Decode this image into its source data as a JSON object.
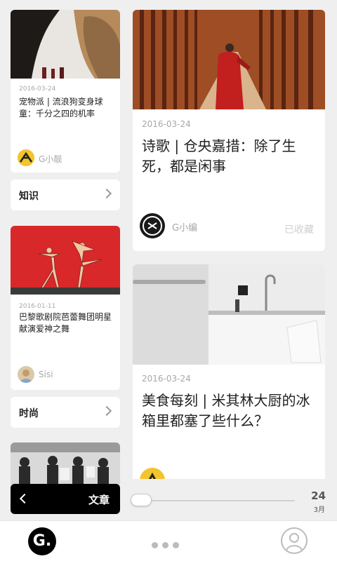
{
  "left_cards": [
    {
      "date": "2016-03-24",
      "title": "宠物派 | 流浪狗变身球童：千分之四的机率",
      "author": "G小靓"
    },
    {
      "date": "2016-01-11",
      "title": "巴黎歌剧院芭蕾舞团明星献演爱神之舞",
      "author": "Sisi"
    }
  ],
  "categories": [
    {
      "label": "知识"
    },
    {
      "label": "时尚"
    }
  ],
  "right_cards": [
    {
      "date": "2016-03-24",
      "title": "诗歌 | 仓央嘉措：除了生死，都是闲事",
      "author": "G小编",
      "status": "已收藏"
    },
    {
      "date": "2016-03-24",
      "title": "美食每刻 | 米其林大厨的冰箱里都塞了些什么？"
    }
  ],
  "article_pill": {
    "label": "文章"
  },
  "date_slider": {
    "day": "24",
    "month": "3月",
    "progress": 0.05
  },
  "tabbar": {
    "logo": "G.",
    "icons": [
      "more-dots-icon",
      "user-profile-icon"
    ]
  },
  "colors": {
    "accent": "#000000",
    "background": "#efefef"
  }
}
